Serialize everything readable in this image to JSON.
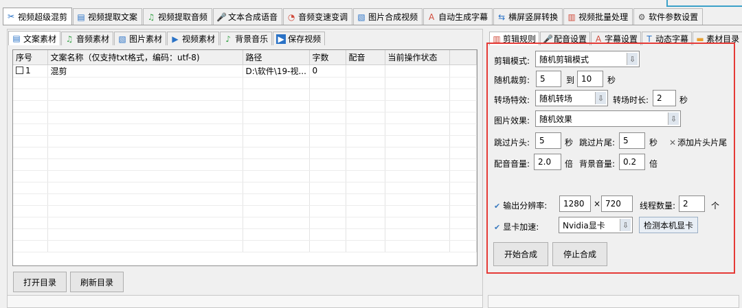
{
  "top_tabs": [
    {
      "label": "视频超级混剪",
      "icon": "✂"
    },
    {
      "label": "视频提取文案",
      "icon": "▤"
    },
    {
      "label": "视频提取音频",
      "icon": "♫"
    },
    {
      "label": "文本合成语音",
      "icon": "🎤"
    },
    {
      "label": "音频变速变调",
      "icon": "◔"
    },
    {
      "label": "图片合成视频",
      "icon": "▧"
    },
    {
      "label": "自动生成字幕",
      "icon": "A"
    },
    {
      "label": "横屏竖屏转换",
      "icon": "⇆"
    },
    {
      "label": "视频批量处理",
      "icon": "▥"
    },
    {
      "label": "软件参数设置",
      "icon": "⚙"
    }
  ],
  "sub_tabs": [
    {
      "label": "文案素材",
      "icon": "▤"
    },
    {
      "label": "音频素材",
      "icon": "♫"
    },
    {
      "label": "图片素材",
      "icon": "▧"
    },
    {
      "label": "视频素材",
      "icon": "▶"
    },
    {
      "label": "背景音乐",
      "icon": "♪"
    },
    {
      "label": "保存视频",
      "icon": "▶"
    }
  ],
  "table": {
    "headers": [
      "序号",
      "文案名称（仅支持txt格式，编码：utf-8)",
      "路径",
      "字数",
      "配音",
      "当前操作状态",
      ""
    ],
    "rows": [
      {
        "index": "1",
        "name": "混剪",
        "path": "D:\\软件\\19-视...",
        "count": "0",
        "voice": "",
        "status": ""
      }
    ]
  },
  "buttons": {
    "open_dir": "打开目录",
    "refresh_dir": "刷新目录"
  },
  "right_tabs": [
    {
      "label": "剪辑规则",
      "icon": "▥"
    },
    {
      "label": "配音设置",
      "icon": "🎤"
    },
    {
      "label": "字幕设置",
      "icon": "A"
    },
    {
      "label": "动态字幕",
      "icon": "T"
    },
    {
      "label": "素材目录",
      "icon": "▬"
    }
  ],
  "settings": {
    "edit_mode_label": "剪辑模式:",
    "edit_mode_value": "随机剪辑模式",
    "random_cut_label": "随机裁剪:",
    "random_cut_min": "5",
    "to_label": "到",
    "random_cut_max": "10",
    "seconds": "秒",
    "transition_label": "转场特效:",
    "transition_value": "随机转场",
    "transition_duration_label": "转场时长:",
    "transition_duration": "2",
    "image_effect_label": "图片效果:",
    "image_effect_value": "随机效果",
    "skip_head_label": "跳过片头:",
    "skip_head": "5",
    "skip_tail_label": "跳过片尾:",
    "skip_tail": "5",
    "add_head_tail": "添加片头片尾",
    "add_head_tail_icon": "✕",
    "dub_volume_label": "配音音量:",
    "dub_volume": "2.0",
    "times": "倍",
    "bg_volume_label": "背景音量:",
    "bg_volume": "0.2",
    "output_res_label": "输出分辨率:",
    "res_width": "1280",
    "x_sep": "×",
    "res_height": "720",
    "threads_label": "线程数量:",
    "threads": "2",
    "unit_ge": "个",
    "gpu_label": "显卡加速:",
    "gpu_value": "Nvidia显卡",
    "detect_gpu": "检测本机显卡",
    "start": "开始合成",
    "stop": "停止合成"
  },
  "colors": {
    "highlight_border": "#e53935",
    "accent": "#3b7bbf"
  }
}
